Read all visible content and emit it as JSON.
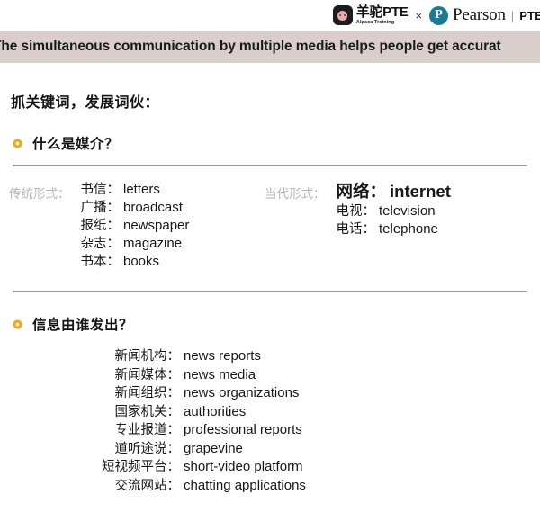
{
  "header": {
    "alpaca": {
      "title": "羊驼PTE",
      "subtitle": "Alpaca Training",
      "mark_color": "#1c1c1c"
    },
    "separator": "×",
    "pearson": {
      "mark_letter": "P",
      "mark_color": "#1a7b96",
      "name": "Pearson",
      "divider": "|",
      "product": "PTE A"
    }
  },
  "banner": {
    "text": "The simultaneous communication by multiple media helps people get accurat",
    "background": "#d9cecb"
  },
  "main": {
    "section_title": "抓关键词，发展词伙：",
    "bullet_color": "#f0a722",
    "sections": [
      {
        "bullet_icon": "starburst-icon",
        "heading": "什么是媒介？",
        "columns": [
          {
            "caption": "传统形式：",
            "terms": [
              {
                "cn": "书信：",
                "en": "letters"
              },
              {
                "cn": "广播：",
                "en": "broadcast"
              },
              {
                "cn": "报纸：",
                "en": "newspaper"
              },
              {
                "cn": "杂志：",
                "en": "magazine"
              },
              {
                "cn": "书本：",
                "en": "books"
              }
            ]
          },
          {
            "caption": "当代形式：",
            "terms": [
              {
                "cn": "网络：",
                "en": "internet",
                "emphasis": true
              },
              {
                "cn": "电视：",
                "en": "television"
              },
              {
                "cn": "电话：",
                "en": "telephone"
              }
            ]
          }
        ]
      },
      {
        "bullet_icon": "starburst-icon",
        "heading": "信息由谁发出？",
        "sources": [
          {
            "cn": "新闻机构：",
            "en": "news reports"
          },
          {
            "cn": "新闻媒体：",
            "en": "news media"
          },
          {
            "cn": "新闻组织：",
            "en": "news organizations"
          },
          {
            "cn": "国家机关：",
            "en": "authorities"
          },
          {
            "cn": "专业报道：",
            "en": "professional reports"
          },
          {
            "cn": "道听途说：",
            "en": "grapevine"
          },
          {
            "cn": "短视频平台：",
            "en": "short-video platform"
          },
          {
            "cn": "交流网站：",
            "en": "chatting applications"
          }
        ]
      }
    ]
  }
}
